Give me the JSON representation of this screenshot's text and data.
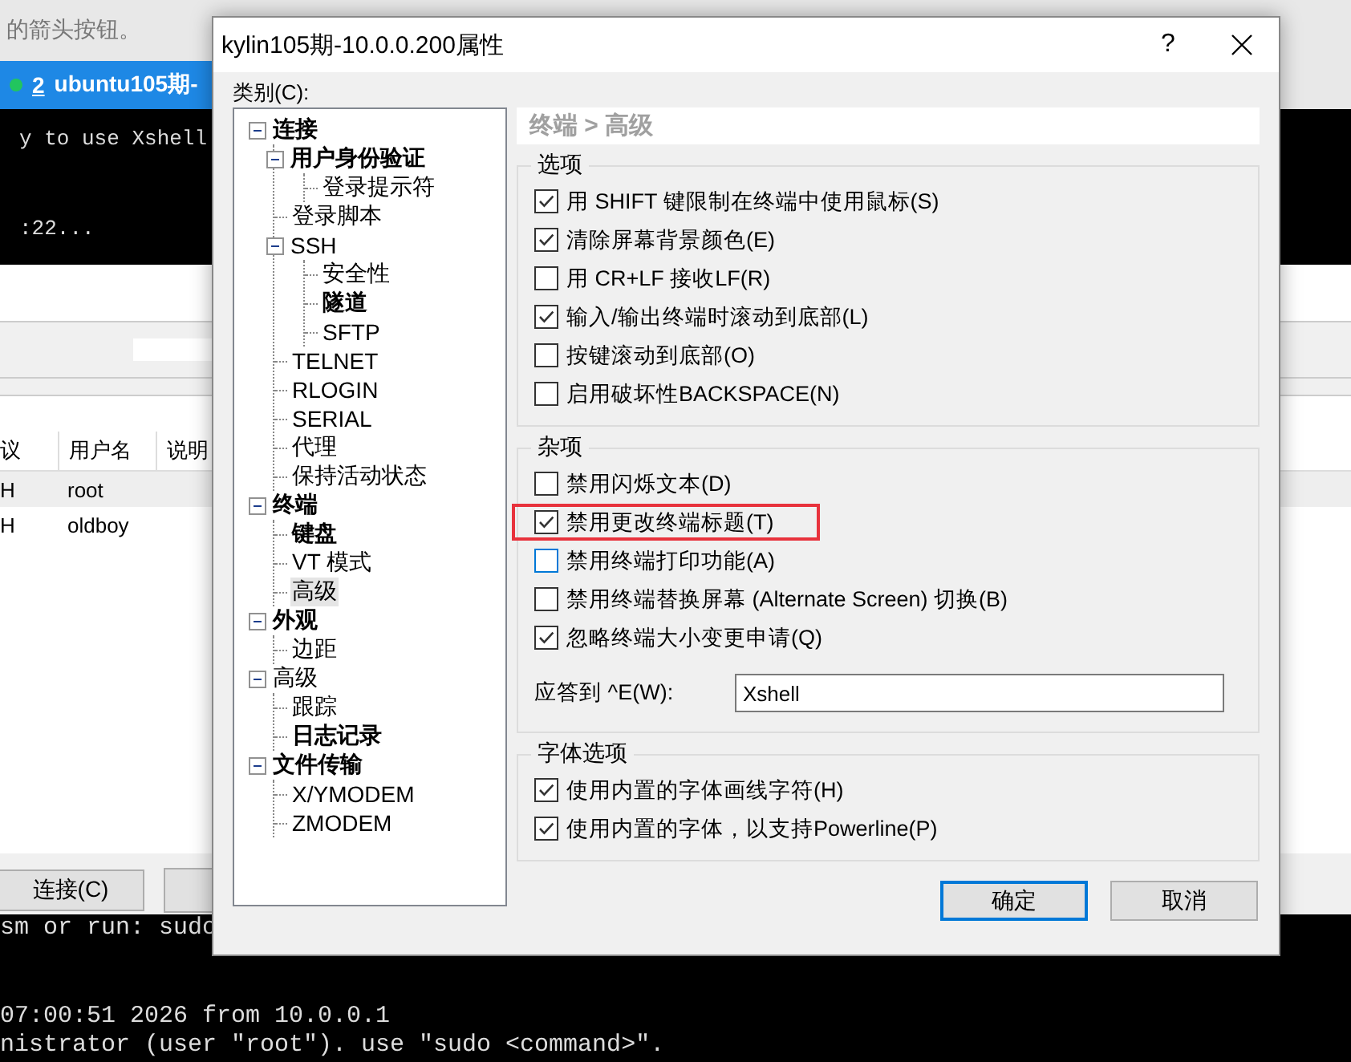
{
  "background_app": {
    "hint_text": "的箭头按钮。",
    "tab": {
      "number": "2",
      "title": "ubuntu105期-",
      "connected": true
    },
    "terminal_top": [
      "y to use Xshell",
      ":22..."
    ],
    "session_table": {
      "columns": [
        "议",
        "用户名",
        "说明"
      ],
      "rows": [
        {
          "cells": [
            "H",
            "root"
          ],
          "selected": true
        },
        {
          "cells": [
            "H",
            "oldboy"
          ],
          "selected": false
        }
      ]
    },
    "buttons": [
      "连接(C)"
    ],
    "terminal_bottom": [
      "sm or run: sudo",
      "07:00:51 2026 from 10.0.0.1",
      "nistrator (user \"root\"). use \"sudo <command>\"."
    ]
  },
  "dialog": {
    "title": "kylin105期-10.0.0.200属性",
    "help": "?",
    "category_label": "类别(C):",
    "tree": [
      {
        "label": "连接",
        "bold": true,
        "expanded": true,
        "selected": false,
        "children": [
          {
            "label": "用户身份验证",
            "bold": true,
            "expanded": true,
            "selected": false,
            "children": [
              {
                "label": "登录提示符",
                "bold": false,
                "selected": false
              }
            ]
          },
          {
            "label": "登录脚本",
            "bold": false,
            "selected": false
          },
          {
            "label": "SSH",
            "bold": false,
            "expanded": true,
            "selected": false,
            "children": [
              {
                "label": "安全性",
                "bold": false,
                "selected": false
              },
              {
                "label": "隧道",
                "bold": true,
                "selected": false
              },
              {
                "label": "SFTP",
                "bold": false,
                "selected": false
              }
            ]
          },
          {
            "label": "TELNET",
            "bold": false,
            "selected": false
          },
          {
            "label": "RLOGIN",
            "bold": false,
            "selected": false
          },
          {
            "label": "SERIAL",
            "bold": false,
            "selected": false
          },
          {
            "label": "代理",
            "bold": false,
            "selected": false
          },
          {
            "label": "保持活动状态",
            "bold": false,
            "selected": false
          }
        ]
      },
      {
        "label": "终端",
        "bold": true,
        "expanded": true,
        "selected": false,
        "children": [
          {
            "label": "键盘",
            "bold": true,
            "selected": false
          },
          {
            "label": "VT 模式",
            "bold": false,
            "selected": false
          },
          {
            "label": "高级",
            "bold": false,
            "selected": true
          }
        ]
      },
      {
        "label": "外观",
        "bold": true,
        "expanded": true,
        "selected": false,
        "children": [
          {
            "label": "边距",
            "bold": false,
            "selected": false
          }
        ]
      },
      {
        "label": "高级",
        "bold": false,
        "expanded": true,
        "selected": false,
        "children": [
          {
            "label": "跟踪",
            "bold": false,
            "selected": false
          },
          {
            "label": "日志记录",
            "bold": true,
            "selected": false
          }
        ]
      },
      {
        "label": "文件传输",
        "bold": true,
        "expanded": true,
        "selected": false,
        "children": [
          {
            "label": "X/YMODEM",
            "bold": false,
            "selected": false
          },
          {
            "label": "ZMODEM",
            "bold": false,
            "selected": false
          }
        ]
      }
    ],
    "breadcrumb": "终端 > 高级",
    "groups": [
      {
        "title": "选项",
        "options": [
          {
            "label": "用 SHIFT 键限制在终端中使用鼠标(S)",
            "checked": true,
            "focused": false,
            "highlighted": false
          },
          {
            "label": "清除屏幕背景颜色(E)",
            "checked": true,
            "focused": false,
            "highlighted": false
          },
          {
            "label": "用 CR+LF 接收LF(R)",
            "checked": false,
            "focused": false,
            "highlighted": false
          },
          {
            "label": "输入/输出终端时滚动到底部(L)",
            "checked": true,
            "focused": false,
            "highlighted": false
          },
          {
            "label": "按键滚动到底部(O)",
            "checked": false,
            "focused": false,
            "highlighted": false
          },
          {
            "label": "启用破坏性BACKSPACE(N)",
            "checked": false,
            "focused": false,
            "highlighted": false
          }
        ]
      },
      {
        "title": "杂项",
        "options": [
          {
            "label": "禁用闪烁文本(D)",
            "checked": false,
            "focused": false,
            "highlighted": false
          },
          {
            "label": "禁用更改终端标题(T)",
            "checked": true,
            "focused": false,
            "highlighted": true
          },
          {
            "label": "禁用终端打印功能(A)",
            "checked": false,
            "focused": true,
            "highlighted": false
          },
          {
            "label": "禁用终端替换屏幕 (Alternate Screen) 切换(B)",
            "checked": false,
            "focused": false,
            "highlighted": false
          },
          {
            "label": "忽略终端大小变更申请(Q)",
            "checked": true,
            "focused": false,
            "highlighted": false
          }
        ],
        "field": {
          "label": "应答到 ^E(W):",
          "value": "Xshell"
        }
      },
      {
        "title": "字体选项",
        "options": [
          {
            "label": "使用内置的字体画线字符(H)",
            "checked": true,
            "focused": false,
            "highlighted": false
          },
          {
            "label": "使用内置的字体，以支持Powerline(P)",
            "checked": true,
            "focused": false,
            "highlighted": false
          }
        ]
      }
    ],
    "buttons": [
      {
        "label": "确定",
        "default": true
      },
      {
        "label": "取消",
        "default": false
      }
    ]
  }
}
